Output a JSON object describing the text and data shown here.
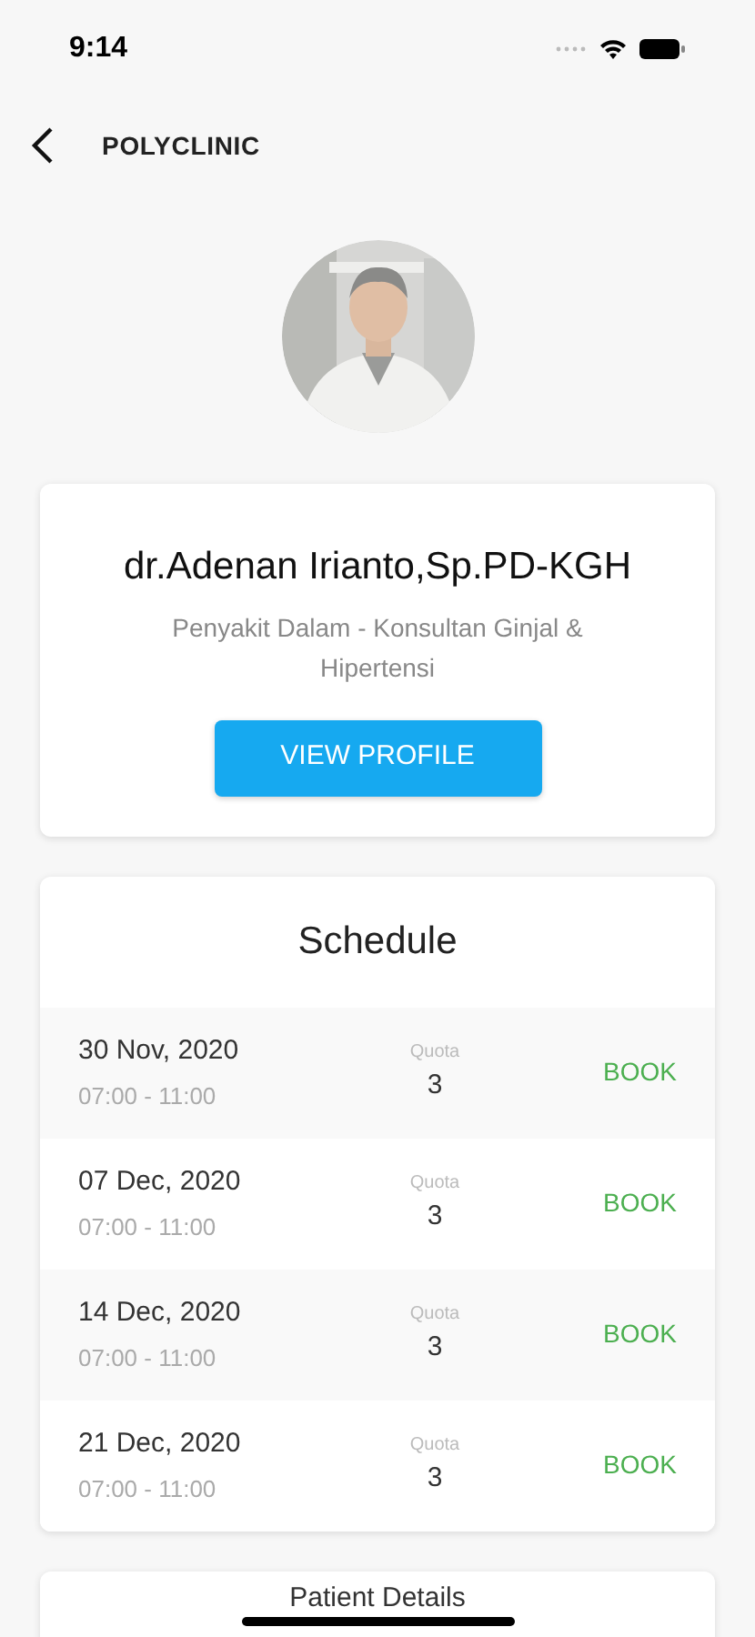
{
  "status_bar": {
    "time": "9:14"
  },
  "nav": {
    "title": "POLYCLINIC"
  },
  "doctor": {
    "name": "dr.Adenan Irianto,Sp.PD-KGH",
    "specialty": "Penyakit Dalam - Konsultan Ginjal & Hipertensi",
    "button": "VIEW PROFILE"
  },
  "schedule": {
    "title": "Schedule",
    "rows": [
      {
        "date": "30 Nov, 2020",
        "time": "07:00 - 11:00",
        "quota_label": "Quota",
        "quota": "3",
        "action": "BOOK"
      },
      {
        "date": "07 Dec, 2020",
        "time": "07:00 - 11:00",
        "quota_label": "Quota",
        "quota": "3",
        "action": "BOOK"
      },
      {
        "date": "14 Dec, 2020",
        "time": "07:00 - 11:00",
        "quota_label": "Quota",
        "quota": "3",
        "action": "BOOK"
      },
      {
        "date": "21 Dec, 2020",
        "time": "07:00 - 11:00",
        "quota_label": "Quota",
        "quota": "3",
        "action": "BOOK"
      }
    ]
  },
  "patient": {
    "title": "Patient Details"
  }
}
